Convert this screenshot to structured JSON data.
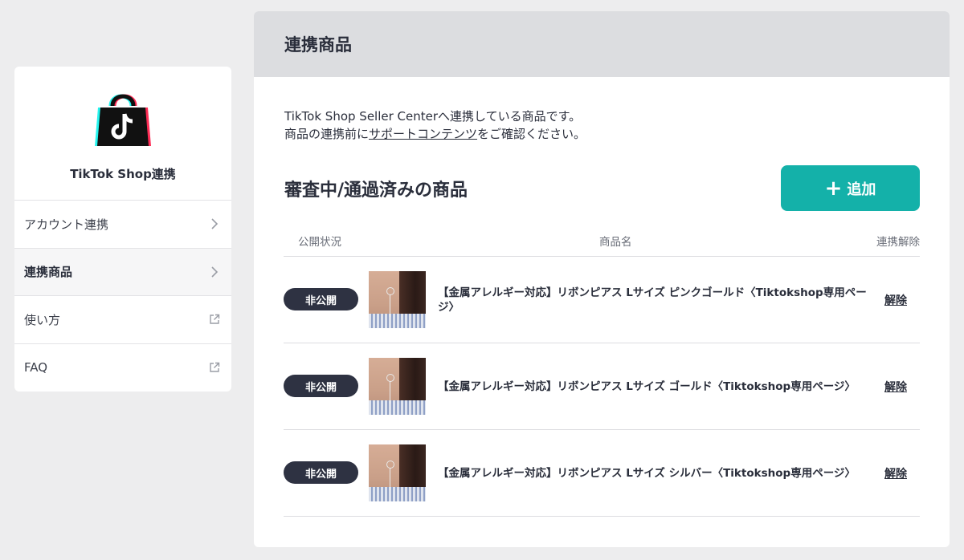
{
  "sidebar": {
    "title": "TikTok Shop連携",
    "items": [
      {
        "label": "アカウント連携",
        "icon": "chevron-right-icon",
        "active": false
      },
      {
        "label": "連携商品",
        "icon": "chevron-right-icon",
        "active": true
      },
      {
        "label": "使い方",
        "icon": "external-link-icon",
        "active": false
      },
      {
        "label": "FAQ",
        "icon": "external-link-icon",
        "active": false
      }
    ]
  },
  "main": {
    "header_title": "連携商品",
    "description": {
      "line1": "TikTok Shop Seller Centerへ連携している商品です。",
      "line2_prefix": "商品の連携前に",
      "line2_link": "サポートコンテンツ",
      "line2_suffix": "をご確認ください。"
    },
    "section_title": "審査中/通過済みの商品",
    "add_button": {
      "icon": "+",
      "label": "追加"
    },
    "table": {
      "headers": {
        "status": "公開状況",
        "name": "商品名",
        "unlink": "連携解除"
      },
      "rows": [
        {
          "status": "非公開",
          "name": "【金属アレルギー対応】リボンピアス Lサイズ ピンクゴールド〈Tiktokshop専用ページ〉",
          "unlink": "解除"
        },
        {
          "status": "非公開",
          "name": "【金属アレルギー対応】リボンピアス Lサイズ ゴールド〈Tiktokshop専用ページ〉",
          "unlink": "解除"
        },
        {
          "status": "非公開",
          "name": "【金属アレルギー対応】リボンピアス Lサイズ シルバー〈Tiktokshop専用ページ〉",
          "unlink": "解除"
        }
      ]
    }
  },
  "colors": {
    "accent": "#14b1a9",
    "badge": "#2e3242",
    "header_bg": "#dcdde0",
    "page_bg": "#ededee"
  }
}
